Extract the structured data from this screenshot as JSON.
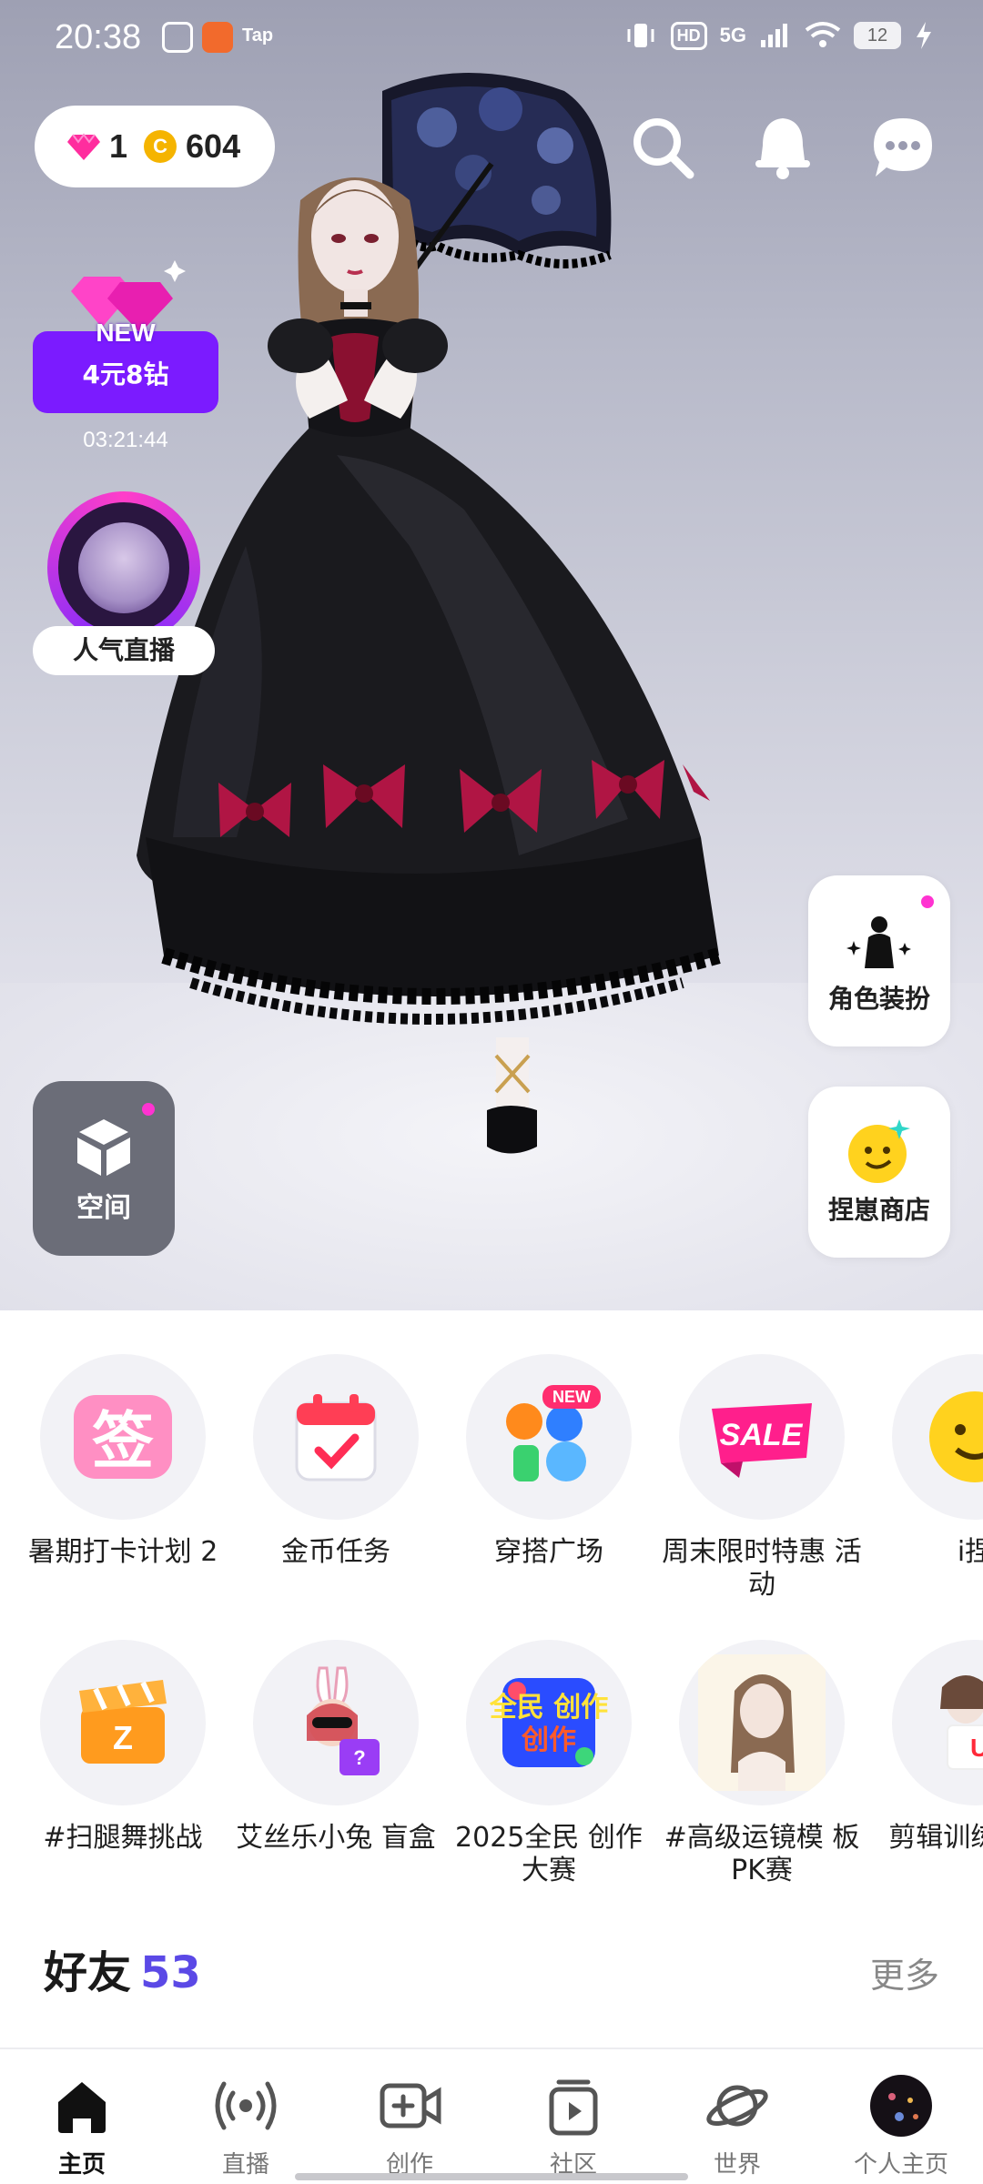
{
  "status_bar": {
    "time": "20:38",
    "left_icons": [
      "app-icon",
      "app-icon",
      "tap-app-icon"
    ],
    "tap_label": "Tap",
    "hd_label": "HD",
    "network_label": "5G",
    "battery_level": "12"
  },
  "currency": {
    "diamonds": "1",
    "coins": "604",
    "coin_symbol": "C"
  },
  "top_actions": [
    "search-icon",
    "bell-icon",
    "chat-icon"
  ],
  "offer": {
    "new_label": "NEW",
    "price_label": "4元8钻",
    "countdown": "03:21:44"
  },
  "live": {
    "label": "人气直播"
  },
  "side_buttons": {
    "costume": "角色装扮",
    "shop": "捏崽商店",
    "space": "空间"
  },
  "features_row1": [
    {
      "label": "暑期打卡计划 2",
      "icon": "sign-in-icon"
    },
    {
      "label": "金币任务",
      "icon": "calendar-check-icon"
    },
    {
      "label": "穿搭广场",
      "icon": "ootd-icon",
      "badge": "NEW"
    },
    {
      "label": "周末限时特惠 活动",
      "icon": "sale-tag-icon",
      "badge": "SALE"
    },
    {
      "label": "i捏",
      "icon": "smiley-icon"
    }
  ],
  "features_row2": [
    {
      "label": "#扫腿舞挑战",
      "icon": "clapperboard-icon"
    },
    {
      "label": "艾丝乐小兔 盲盒",
      "icon": "blind-box-icon"
    },
    {
      "label": "2025全民 创作大赛",
      "icon": "contest-icon",
      "art_text": "全民 创作"
    },
    {
      "label": "#高级运镜模 板PK赛",
      "icon": "portrait-icon"
    },
    {
      "label": "剪辑训练 三期",
      "icon": "ugc-icon",
      "art_text": "UG"
    }
  ],
  "friends": {
    "title": "好友",
    "count": "53",
    "more": "更多"
  },
  "tabs": [
    {
      "label": "主页",
      "icon": "home-icon",
      "active": true
    },
    {
      "label": "直播",
      "icon": "broadcast-icon",
      "active": false
    },
    {
      "label": "创作",
      "icon": "video-add-icon",
      "active": false
    },
    {
      "label": "社区",
      "icon": "community-icon",
      "active": false
    },
    {
      "label": "世界",
      "icon": "planet-icon",
      "active": false
    },
    {
      "label": "个人主页",
      "icon": "profile-avatar",
      "active": false
    }
  ],
  "colors": {
    "accent_purple": "#7b1bff",
    "friends_count": "#5b49e6",
    "notification_dot": "#ff33d1",
    "coin_gold": "#f5b400",
    "dress_red": "#b01544"
  }
}
